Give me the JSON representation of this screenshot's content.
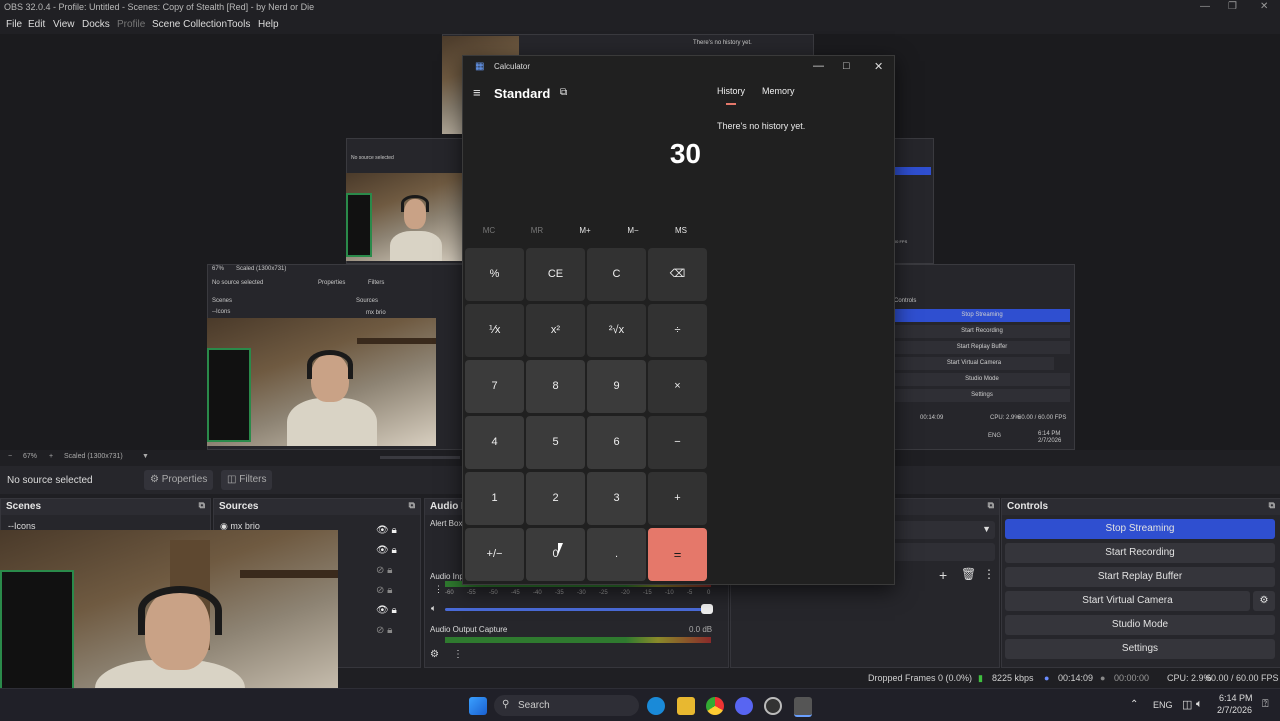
{
  "obs": {
    "title": "OBS 32.0.4 - Profile: Untitled - Scenes: Copy of Stealth [Red] - by Nerd or Die",
    "menu": [
      "File",
      "Edit",
      "View",
      "Docks",
      "Profile",
      "Scene Collection",
      "Tools",
      "Help"
    ],
    "preview_bar": {
      "zoom": "67%",
      "scaled": "Scaled (1300x731)"
    },
    "source_bar": {
      "no_source": "No source selected",
      "properties": "Properties",
      "filters": "Filters"
    },
    "docks": {
      "scenes": "Scenes",
      "sources": "Sources",
      "audio": "Audio M",
      "controls": "Controls"
    },
    "scenes_items": [
      "--Icons"
    ],
    "sources_items": [
      "mx brio"
    ],
    "audio": {
      "alert_box": "Alert Box",
      "audio_input": "Audio Inp",
      "audio_output": "Audio Output Capture",
      "audio_output_db": "0.0 dB",
      "ticks": [
        "-60",
        "-55",
        "-50",
        "-45",
        "-40",
        "-35",
        "-30",
        "-25",
        "-20",
        "-15",
        "-10",
        "-5",
        "0"
      ]
    },
    "controls": {
      "stop_streaming": "Stop Streaming",
      "start_recording": "Start Recording",
      "start_replay": "Start Replay Buffer",
      "start_virtual_cam": "Start Virtual Camera",
      "studio_mode": "Studio Mode",
      "settings": "Settings"
    },
    "status": {
      "dropped": "Dropped Frames 0 (0.0%)",
      "kbps": "8225 kbps",
      "stream_time": "00:14:09",
      "rec_time": "00:00:00",
      "cpu": "CPU: 2.9%",
      "fps": "60.00 / 60.00 FPS"
    },
    "nested": {
      "no_source": "No source selected",
      "properties": "Properties",
      "filters": "Filters",
      "scenes": "Scenes",
      "sources": "Sources",
      "icons": "--Icons",
      "mx_brio": "mx brio",
      "zoom": "67%",
      "scaled": "Scaled (1300x731)",
      "history_empty": "There's no history yet.",
      "controls": "Controls",
      "stop_streaming": "Stop Streaming",
      "start_recording": "Start Recording",
      "start_replay": "Start Replay Buffer",
      "start_virtual_cam": "Start Virtual Camera",
      "studio_mode": "Studio Mode",
      "settings": "Settings",
      "time": "00:14:09",
      "cpu": "CPU: 2.9%",
      "fps": "60.00 / 60.00 FPS",
      "lang": "ENG",
      "clock_time": "6:14 PM",
      "clock_date": "2/7/2026",
      "fps_small": "60.00 / 60.00 FPS"
    }
  },
  "calculator": {
    "title": "Calculator",
    "mode": "Standard",
    "display": "30",
    "tabs": {
      "history": "History",
      "memory": "Memory"
    },
    "history_empty": "There's no history yet.",
    "memory_buttons": [
      "MC",
      "MR",
      "M+",
      "M−",
      "MS"
    ],
    "keys": [
      [
        "%",
        "CE",
        "C",
        "⌫"
      ],
      [
        "⅟x",
        "x²",
        "²√x",
        "÷"
      ],
      [
        "7",
        "8",
        "9",
        "×"
      ],
      [
        "4",
        "5",
        "6",
        "−"
      ],
      [
        "1",
        "2",
        "3",
        "+"
      ],
      [
        "+/−",
        "0",
        ".",
        "="
      ]
    ],
    "accent": "#e5786a"
  },
  "taskbar": {
    "search": "Search",
    "lang": "ENG",
    "time": "6:14 PM",
    "date": "2/7/2026"
  }
}
